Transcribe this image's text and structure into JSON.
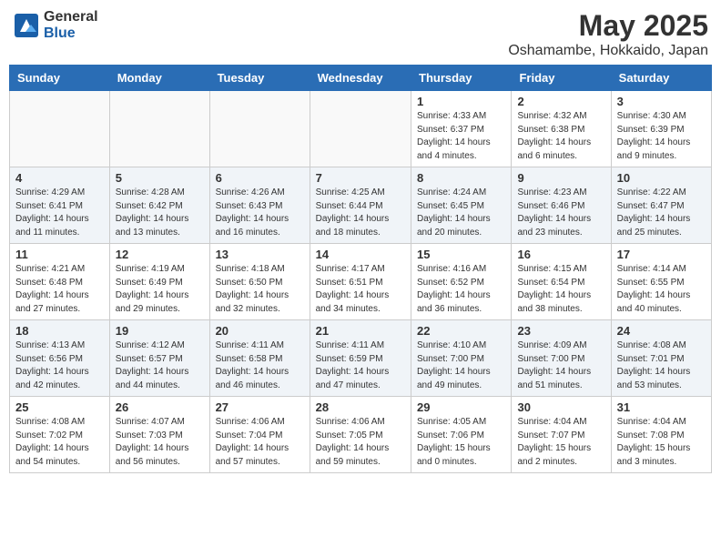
{
  "header": {
    "logo_general": "General",
    "logo_blue": "Blue",
    "month_year": "May 2025",
    "location": "Oshamambe, Hokkaido, Japan"
  },
  "weekdays": [
    "Sunday",
    "Monday",
    "Tuesday",
    "Wednesday",
    "Thursday",
    "Friday",
    "Saturday"
  ],
  "weeks": [
    [
      {
        "day": "",
        "info": ""
      },
      {
        "day": "",
        "info": ""
      },
      {
        "day": "",
        "info": ""
      },
      {
        "day": "",
        "info": ""
      },
      {
        "day": "1",
        "info": "Sunrise: 4:33 AM\nSunset: 6:37 PM\nDaylight: 14 hours\nand 4 minutes."
      },
      {
        "day": "2",
        "info": "Sunrise: 4:32 AM\nSunset: 6:38 PM\nDaylight: 14 hours\nand 6 minutes."
      },
      {
        "day": "3",
        "info": "Sunrise: 4:30 AM\nSunset: 6:39 PM\nDaylight: 14 hours\nand 9 minutes."
      }
    ],
    [
      {
        "day": "4",
        "info": "Sunrise: 4:29 AM\nSunset: 6:41 PM\nDaylight: 14 hours\nand 11 minutes."
      },
      {
        "day": "5",
        "info": "Sunrise: 4:28 AM\nSunset: 6:42 PM\nDaylight: 14 hours\nand 13 minutes."
      },
      {
        "day": "6",
        "info": "Sunrise: 4:26 AM\nSunset: 6:43 PM\nDaylight: 14 hours\nand 16 minutes."
      },
      {
        "day": "7",
        "info": "Sunrise: 4:25 AM\nSunset: 6:44 PM\nDaylight: 14 hours\nand 18 minutes."
      },
      {
        "day": "8",
        "info": "Sunrise: 4:24 AM\nSunset: 6:45 PM\nDaylight: 14 hours\nand 20 minutes."
      },
      {
        "day": "9",
        "info": "Sunrise: 4:23 AM\nSunset: 6:46 PM\nDaylight: 14 hours\nand 23 minutes."
      },
      {
        "day": "10",
        "info": "Sunrise: 4:22 AM\nSunset: 6:47 PM\nDaylight: 14 hours\nand 25 minutes."
      }
    ],
    [
      {
        "day": "11",
        "info": "Sunrise: 4:21 AM\nSunset: 6:48 PM\nDaylight: 14 hours\nand 27 minutes."
      },
      {
        "day": "12",
        "info": "Sunrise: 4:19 AM\nSunset: 6:49 PM\nDaylight: 14 hours\nand 29 minutes."
      },
      {
        "day": "13",
        "info": "Sunrise: 4:18 AM\nSunset: 6:50 PM\nDaylight: 14 hours\nand 32 minutes."
      },
      {
        "day": "14",
        "info": "Sunrise: 4:17 AM\nSunset: 6:51 PM\nDaylight: 14 hours\nand 34 minutes."
      },
      {
        "day": "15",
        "info": "Sunrise: 4:16 AM\nSunset: 6:52 PM\nDaylight: 14 hours\nand 36 minutes."
      },
      {
        "day": "16",
        "info": "Sunrise: 4:15 AM\nSunset: 6:54 PM\nDaylight: 14 hours\nand 38 minutes."
      },
      {
        "day": "17",
        "info": "Sunrise: 4:14 AM\nSunset: 6:55 PM\nDaylight: 14 hours\nand 40 minutes."
      }
    ],
    [
      {
        "day": "18",
        "info": "Sunrise: 4:13 AM\nSunset: 6:56 PM\nDaylight: 14 hours\nand 42 minutes."
      },
      {
        "day": "19",
        "info": "Sunrise: 4:12 AM\nSunset: 6:57 PM\nDaylight: 14 hours\nand 44 minutes."
      },
      {
        "day": "20",
        "info": "Sunrise: 4:11 AM\nSunset: 6:58 PM\nDaylight: 14 hours\nand 46 minutes."
      },
      {
        "day": "21",
        "info": "Sunrise: 4:11 AM\nSunset: 6:59 PM\nDaylight: 14 hours\nand 47 minutes."
      },
      {
        "day": "22",
        "info": "Sunrise: 4:10 AM\nSunset: 7:00 PM\nDaylight: 14 hours\nand 49 minutes."
      },
      {
        "day": "23",
        "info": "Sunrise: 4:09 AM\nSunset: 7:00 PM\nDaylight: 14 hours\nand 51 minutes."
      },
      {
        "day": "24",
        "info": "Sunrise: 4:08 AM\nSunset: 7:01 PM\nDaylight: 14 hours\nand 53 minutes."
      }
    ],
    [
      {
        "day": "25",
        "info": "Sunrise: 4:08 AM\nSunset: 7:02 PM\nDaylight: 14 hours\nand 54 minutes."
      },
      {
        "day": "26",
        "info": "Sunrise: 4:07 AM\nSunset: 7:03 PM\nDaylight: 14 hours\nand 56 minutes."
      },
      {
        "day": "27",
        "info": "Sunrise: 4:06 AM\nSunset: 7:04 PM\nDaylight: 14 hours\nand 57 minutes."
      },
      {
        "day": "28",
        "info": "Sunrise: 4:06 AM\nSunset: 7:05 PM\nDaylight: 14 hours\nand 59 minutes."
      },
      {
        "day": "29",
        "info": "Sunrise: 4:05 AM\nSunset: 7:06 PM\nDaylight: 15 hours\nand 0 minutes."
      },
      {
        "day": "30",
        "info": "Sunrise: 4:04 AM\nSunset: 7:07 PM\nDaylight: 15 hours\nand 2 minutes."
      },
      {
        "day": "31",
        "info": "Sunrise: 4:04 AM\nSunset: 7:08 PM\nDaylight: 15 hours\nand 3 minutes."
      }
    ]
  ]
}
